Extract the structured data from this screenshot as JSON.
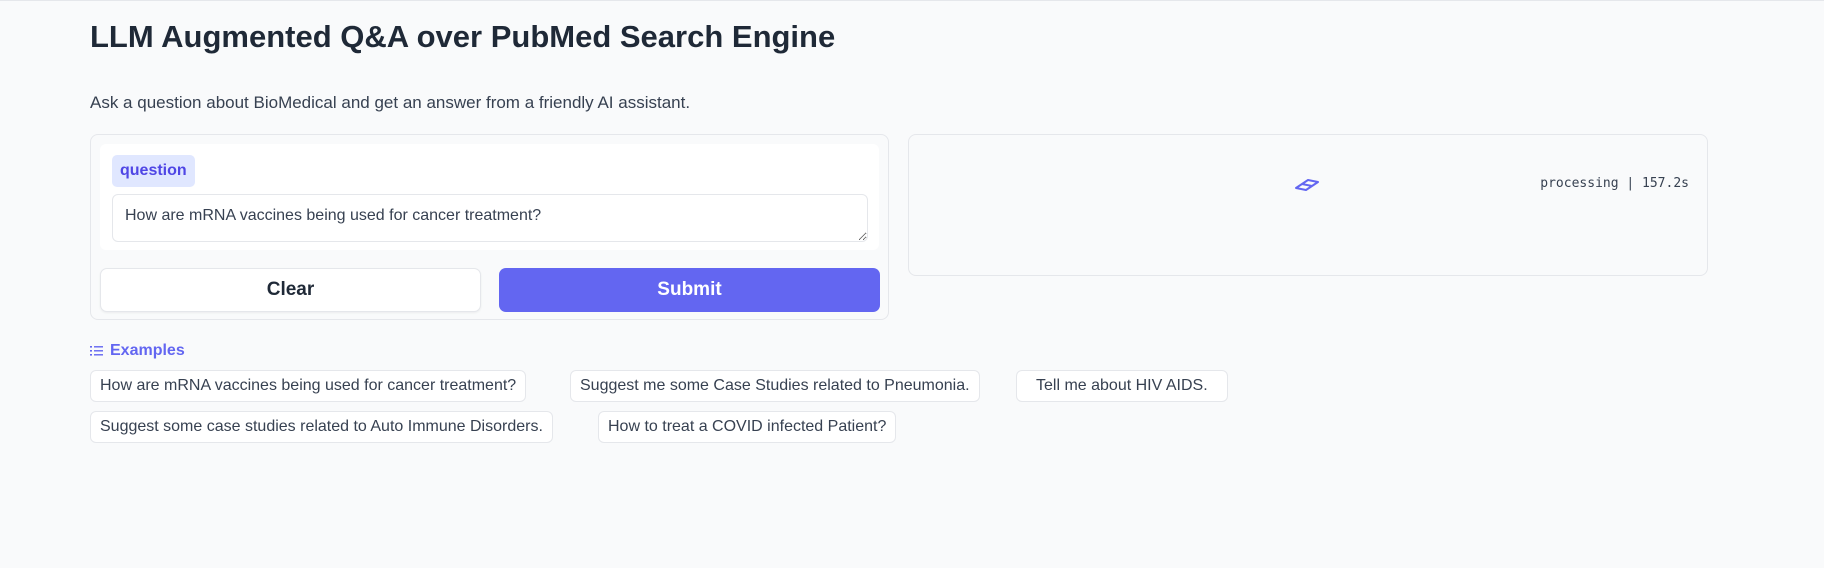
{
  "page": {
    "title": "LLM Augmented Q&A over PubMed Search Engine",
    "description": "Ask a question about BioMedical and get an answer from a friendly AI assistant."
  },
  "input": {
    "label": "question",
    "value": "How are mRNA vaccines being used for cancer treatment?"
  },
  "buttons": {
    "clear_label": "Clear",
    "submit_label": "Submit"
  },
  "output": {
    "status": "processing | 157.2s",
    "loader_icon": "loader-icon"
  },
  "examples": {
    "header": "Examples",
    "icon": "list-icon",
    "items": [
      "How are mRNA vaccines being used for cancer treatment?",
      "Suggest me some Case Studies related to Pneumonia.",
      "Tell me about HIV AIDS.",
      "Suggest some case studies related to Auto Immune Disorders.",
      "How to treat a COVID infected Patient?"
    ]
  },
  "colors": {
    "accent": "#6366f1",
    "label_bg": "#e0e7ff",
    "background": "#f9fafb"
  }
}
